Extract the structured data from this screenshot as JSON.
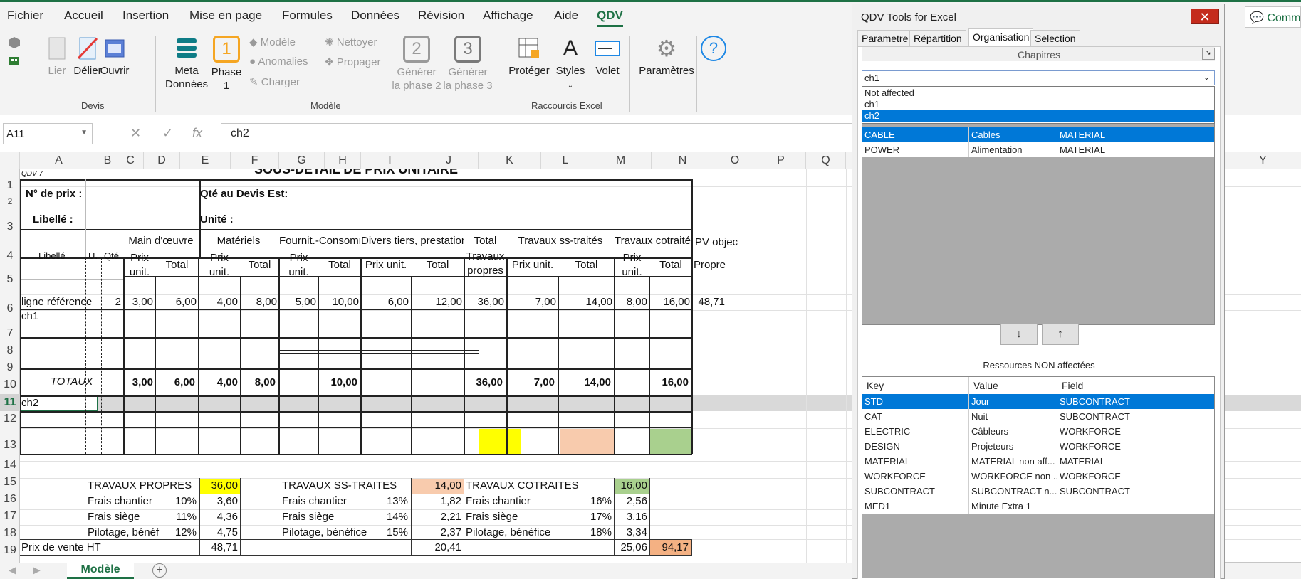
{
  "menu": [
    "Fichier",
    "Accueil",
    "Insertion",
    "Mise en page",
    "Formules",
    "Données",
    "Révision",
    "Affichage",
    "Aide",
    "QDV"
  ],
  "ribbon": {
    "devis": {
      "lier": "Lier",
      "delier": "Délier",
      "ouvrir": "Ouvrir",
      "group": "Devis"
    },
    "modele": {
      "meta1": "Meta",
      "meta2": "Données",
      "phase1a": "Phase",
      "phase1b": "1",
      "phase1_num": "1",
      "modele": "Modèle",
      "anomalies": "Anomalies",
      "charger": "Charger",
      "nettoyer": "Nettoyer",
      "propager": "Propager",
      "gen2a": "Générer",
      "gen2b": "la phase 2",
      "gen2_num": "2",
      "gen3a": "Générer",
      "gen3b": "la phase 3",
      "gen3_num": "3",
      "group": "Modèle"
    },
    "excel": {
      "proteger": "Protéger",
      "styles": "Styles",
      "volet": "Volet",
      "group": "Raccourcis Excel"
    },
    "parametres": "Paramètres",
    "comm": "Comm"
  },
  "formula_bar": {
    "namebox": "A11",
    "x": "✕",
    "check": "✓",
    "fx": "fx",
    "formula": "ch2"
  },
  "columns": [
    "A",
    "B",
    "C",
    "D",
    "E",
    "F",
    "G",
    "H",
    "I",
    "J",
    "K",
    "L",
    "M",
    "N",
    "O",
    "P",
    "Q",
    "Y"
  ],
  "rows": [
    "1",
    "2",
    "3",
    "4",
    "5",
    "6",
    "7",
    "8",
    "9",
    "10",
    "11",
    "12",
    "13",
    "14",
    "15",
    "16",
    "17",
    "18",
    "19"
  ],
  "sheet": {
    "title": "SOUS-DETAIL DE PRIX UNITAIRE",
    "qdv": "QDV 7",
    "n_prix": "N° de prix :",
    "qte_devis": "Qté au Devis Est:",
    "libelle_lbl": "Libellé :",
    "unite": "Unité :",
    "hdr_libelle": "Libellé",
    "hdr_u": "U.",
    "hdr_qte": "Qté",
    "hdr_mo": "Main d'œuvre",
    "hdr_mat": "Matériels",
    "hdr_four": "Fournit.-Consomm",
    "hdr_divers": "Divers tiers, prestations",
    "hdr_total1": "Total",
    "hdr_total2": "Travaux",
    "hdr_total3": "propres",
    "hdr_ss": "Travaux ss-traités",
    "hdr_cot": "Travaux cotraités",
    "hdr_pv": "PV objec",
    "hdr_prix": "Prix",
    "hdr_unit": "unit.",
    "hdr_total": "Total",
    "hdr_prixunit": "Prix unit.",
    "hdr_propre": "Propre",
    "r8": {
      "label": "ligne référence",
      "qte": "2",
      "d": "3,00",
      "e": "6,00",
      "f": "4,00",
      "g": "8,00",
      "h": "5,00",
      "i": "10,00",
      "j": "6,00",
      "k": "12,00",
      "l": "36,00",
      "m": "7,00",
      "n": "14,00",
      "o": "8,00",
      "p": "16,00",
      "q": "48,71"
    },
    "r9": "ch1",
    "r11": "ch2",
    "totaux": {
      "label": "TOTAUX",
      "d": "3,00",
      "e": "6,00",
      "f": "4,00",
      "g": "8,00",
      "i": "10,00",
      "l": "36,00",
      "m": "7,00",
      "n": "14,00",
      "p": "16,00"
    },
    "summary": {
      "tp": "TRAVAUX PROPRES",
      "tp_v": "36,00",
      "tss": "TRAVAUX SS-TRAITES",
      "tss_v": "14,00",
      "tc": "TRAVAUX COTRAITES",
      "tc_v": "16,00",
      "fc": "Frais chantier",
      "fs": "Frais siège",
      "pb1": "Pilotage, bénéf",
      "pb2": "Pilotage, bénéfice",
      "c1": [
        "10%",
        "11%",
        "12%"
      ],
      "v1": [
        "3,60",
        "4,36",
        "4,75"
      ],
      "c2": [
        "13%",
        "14%",
        "15%"
      ],
      "v2": [
        "1,82",
        "2,21",
        "2,37"
      ],
      "c3": [
        "16%",
        "17%",
        "18%"
      ],
      "v3": [
        "2,56",
        "3,16",
        "3,34"
      ],
      "pv": "Prix de vente HT",
      "pv1": "48,71",
      "pv2": "20,41",
      "pv3": "25,06",
      "pvt": "94,17"
    }
  },
  "sheet_tab": "Modèle",
  "panel": {
    "title": "QDV Tools for Excel",
    "close": "✕",
    "tabs": [
      "Parametres",
      "Répartition",
      "Organisation",
      "Selection"
    ],
    "chapitres": "Chapitres",
    "selected": "ch1",
    "options": [
      "Not affected",
      "ch1",
      "ch2"
    ],
    "assigned": [
      {
        "key": "CABLE",
        "value": "Cables",
        "field": "MATERIAL"
      },
      {
        "key": "POWER",
        "value": "Alimentation",
        "field": "MATERIAL"
      }
    ],
    "down": "↓",
    "up": "↑",
    "non_affectees": "Ressources NON affectées",
    "headers": [
      "Key",
      "Value",
      "Field"
    ],
    "resources": [
      {
        "key": "STD",
        "value": "Jour",
        "field": "SUBCONTRACT"
      },
      {
        "key": "CAT",
        "value": "Nuit",
        "field": "SUBCONTRACT"
      },
      {
        "key": "ELECTRIC",
        "value": "Câbleurs",
        "field": "WORKFORCE"
      },
      {
        "key": "DESIGN",
        "value": "Projeteurs",
        "field": "WORKFORCE"
      },
      {
        "key": "MATERIAL",
        "value": "MATERIAL non aff...",
        "field": "MATERIAL"
      },
      {
        "key": "WORKFORCE",
        "value": "WORKFORCE non ...",
        "field": "WORKFORCE"
      },
      {
        "key": "SUBCONTRACT",
        "value": "SUBCONTRACT n...",
        "field": "SUBCONTRACT"
      },
      {
        "key": "MED1",
        "value": "Minute Extra 1",
        "field": ""
      }
    ]
  },
  "colors": {
    "accent": "#1e7145",
    "yellow": "#ffff00",
    "salmon": "#f8cbad",
    "green": "#a9d08e",
    "orange": "#f4b183",
    "selection": "#0078d7"
  }
}
